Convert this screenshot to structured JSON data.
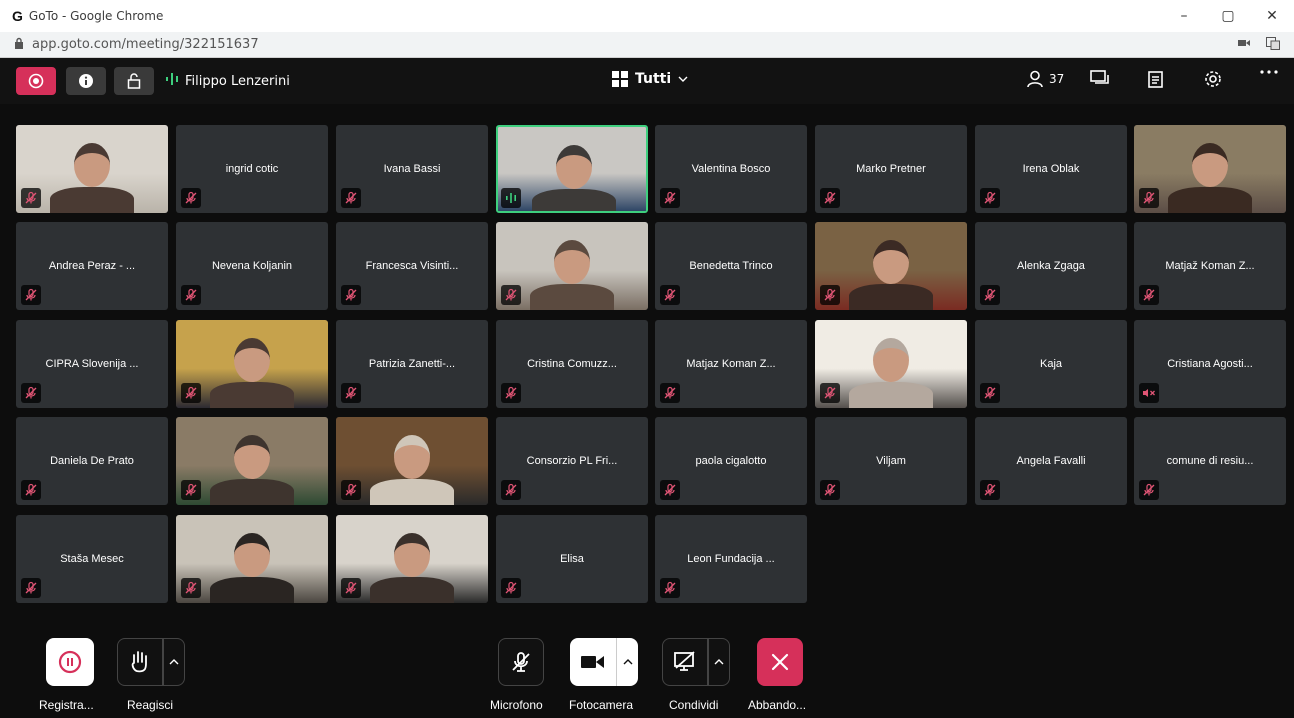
{
  "window": {
    "logo": "G",
    "title": "GoTo - Google Chrome",
    "minimize": "–",
    "restore": "▢",
    "close": "✕",
    "url": "app.goto.com/meeting/322151637"
  },
  "topbar": {
    "speaker_name": "Filippo Lenzerini",
    "view_label": "Tutti",
    "participant_count": "37"
  },
  "colors": {
    "record": "#d6305a",
    "active_speaker": "#3ecf7e",
    "tile_bg": "#2e3134",
    "leave": "#d6305a"
  },
  "tiles": [
    {
      "name": "",
      "video": true,
      "mic": "muted"
    },
    {
      "name": "ingrid cotic",
      "video": false,
      "mic": "muted"
    },
    {
      "name": "Ivana Bassi",
      "video": false,
      "mic": "muted"
    },
    {
      "name": "",
      "video": true,
      "mic": "speaking"
    },
    {
      "name": "Valentina Bosco",
      "video": false,
      "mic": "muted"
    },
    {
      "name": "Marko Pretner",
      "video": false,
      "mic": "muted"
    },
    {
      "name": "Irena Oblak",
      "video": false,
      "mic": "muted"
    },
    {
      "name": "",
      "video": true,
      "mic": "muted"
    },
    {
      "name": "Andrea Peraz - ...",
      "video": false,
      "mic": "muted"
    },
    {
      "name": "Nevena Koljanin",
      "video": false,
      "mic": "muted"
    },
    {
      "name": "Francesca Visinti...",
      "video": false,
      "mic": "muted"
    },
    {
      "name": "",
      "video": true,
      "mic": "muted"
    },
    {
      "name": "Benedetta Trinco",
      "video": false,
      "mic": "muted"
    },
    {
      "name": "",
      "video": true,
      "mic": "muted"
    },
    {
      "name": "Alenka Zgaga",
      "video": false,
      "mic": "muted"
    },
    {
      "name": "Matjaž Koman Z...",
      "video": false,
      "mic": "muted"
    },
    {
      "name": "CIPRA Slovenija ...",
      "video": false,
      "mic": "muted"
    },
    {
      "name": "",
      "video": true,
      "mic": "muted"
    },
    {
      "name": "Patrizia Zanetti-...",
      "video": false,
      "mic": "muted"
    },
    {
      "name": "Cristina Comuzz...",
      "video": false,
      "mic": "muted"
    },
    {
      "name": "Matjaz Koman Z...",
      "video": false,
      "mic": "muted"
    },
    {
      "name": "",
      "video": true,
      "mic": "muted"
    },
    {
      "name": "Kaja",
      "video": false,
      "mic": "muted"
    },
    {
      "name": "Cristiana Agosti...",
      "video": false,
      "mic": "speaker-off"
    },
    {
      "name": "Daniela De Prato",
      "video": false,
      "mic": "muted"
    },
    {
      "name": "",
      "video": true,
      "mic": "muted"
    },
    {
      "name": "",
      "video": true,
      "mic": "muted"
    },
    {
      "name": "Consorzio PL Fri...",
      "video": false,
      "mic": "muted"
    },
    {
      "name": "paola cigalotto",
      "video": false,
      "mic": "muted"
    },
    {
      "name": "Viljam",
      "video": false,
      "mic": "muted"
    },
    {
      "name": "Angela Favalli",
      "video": false,
      "mic": "muted"
    },
    {
      "name": "comune di resiu...",
      "video": false,
      "mic": "muted"
    },
    {
      "name": "Staša Mesec",
      "video": false,
      "mic": "muted"
    },
    {
      "name": "",
      "video": true,
      "mic": "muted"
    },
    {
      "name": "",
      "video": true,
      "mic": "muted"
    },
    {
      "name": "Elisa",
      "video": false,
      "mic": "muted"
    },
    {
      "name": "Leon Fundacija ...",
      "video": false,
      "mic": "muted"
    }
  ],
  "toolbar": {
    "record_label": "Registra...",
    "react_label": "Reagisci",
    "mic_label": "Microfono",
    "camera_label": "Fotocamera",
    "share_label": "Condividi",
    "leave_label": "Abbando..."
  }
}
